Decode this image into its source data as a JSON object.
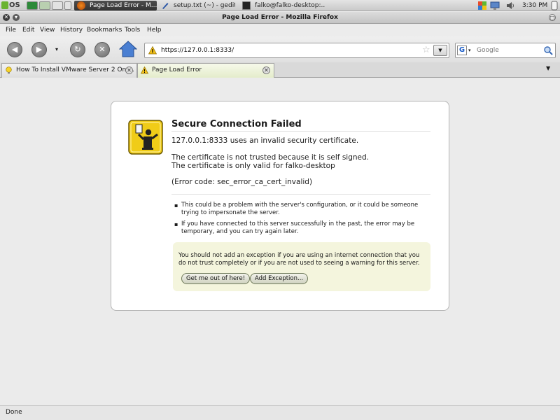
{
  "panel": {
    "os_label": "OS",
    "tasks": [
      "Page Load Error - M...",
      "setup.txt (~) - gedit",
      "falko@falko-desktop:..."
    ],
    "clock": "3:30 PM"
  },
  "window": {
    "title": "Page Load Error - Mozilla Firefox"
  },
  "menubar": {
    "items": [
      "File",
      "Edit",
      "View",
      "History",
      "Bookmarks",
      "Tools",
      "Help"
    ]
  },
  "navbar": {
    "url": "https://127.0.0.1:8333/",
    "search_placeholder": "Google"
  },
  "tabs": [
    {
      "label": "How To Install VMware Server 2 On ..."
    },
    {
      "label": "Page Load Error"
    }
  ],
  "error": {
    "title": "Secure Connection Failed",
    "line1": "127.0.0.1:8333 uses an invalid security certificate.",
    "line2": "The certificate is not trusted because it is self signed.",
    "line3": "The certificate is only valid for falko-desktop",
    "code": "(Error code: sec_error_ca_cert_invalid)",
    "bullets": [
      "This could be a problem with the server's configuration, or it could be someone trying to impersonate the server.",
      "If you have connected to this server successfully in the past, the error may be temporary, and you can try again later."
    ],
    "warning_text": "You should not add an exception if you are using an internet connection that you do not trust completely or if you are not used to seeing a warning for this server.",
    "button_escape": "Get me out of here!",
    "button_exception": "Add Exception..."
  },
  "status": {
    "text": "Done"
  },
  "colors": {
    "error_icon": "#f0cc18",
    "warning_box": "#f4f5dd"
  }
}
